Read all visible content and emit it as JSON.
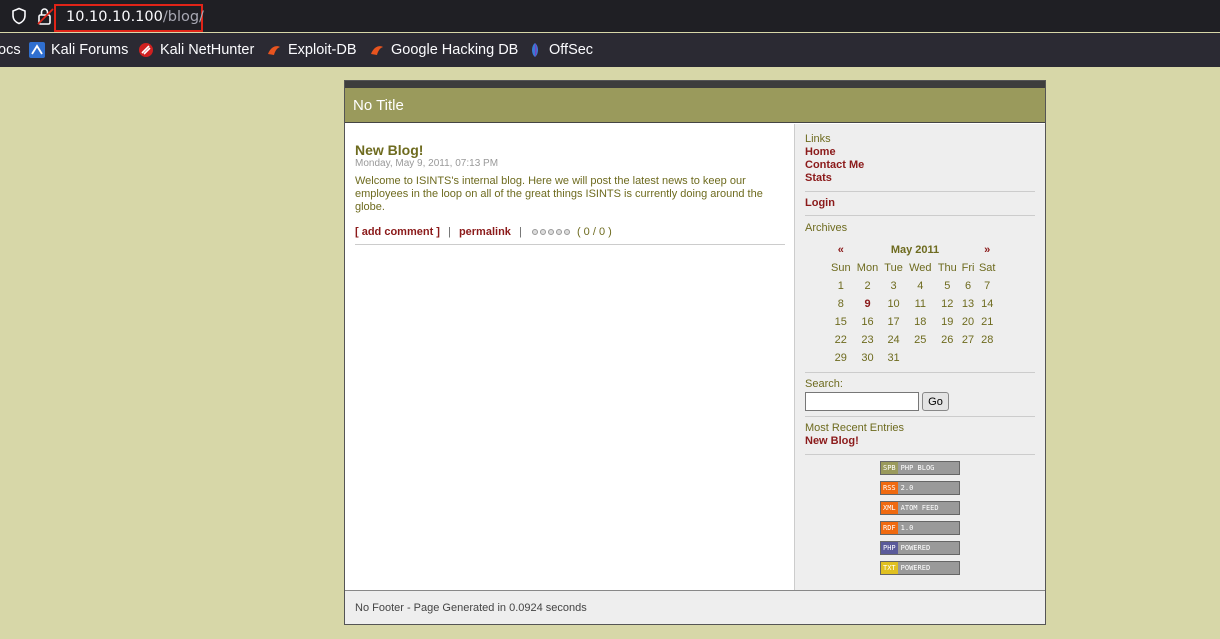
{
  "browser": {
    "url_host": "10.10.10.100",
    "url_path": "/blog/",
    "bookmarks": [
      {
        "label": "ocs",
        "icon": "truncated-bookmark"
      },
      {
        "label": "Kali Forums",
        "icon": "kali-forums-icon"
      },
      {
        "label": "Kali NetHunter",
        "icon": "kali-nethunter-icon"
      },
      {
        "label": "Exploit-DB",
        "icon": "exploit-db-icon"
      },
      {
        "label": "Google Hacking DB",
        "icon": "google-hacking-db-icon"
      },
      {
        "label": "OffSec",
        "icon": "offsec-icon"
      }
    ]
  },
  "blog": {
    "title": "No Title",
    "entry": {
      "title": "New Blog!",
      "date": "Monday, May 9, 2011, 07:13 PM",
      "body": "Welcome to ISINTS's internal blog. Here we will post the latest news to keep our employees in the loop on all of the great things ISINTS is currently doing around the globe.",
      "add_comment": "[ add comment ]",
      "separator": "|",
      "permalink": "permalink",
      "rating": "( 0 / 0 )"
    },
    "sidebar": {
      "links_label": "Links",
      "links": [
        "Home",
        "Contact Me",
        "Stats"
      ],
      "login": "Login",
      "archives_label": "Archives",
      "calendar": {
        "prev": "«",
        "month": "May 2011",
        "next": "»",
        "days_of_week": [
          "Sun",
          "Mon",
          "Tue",
          "Wed",
          "Thu",
          "Fri",
          "Sat"
        ],
        "weeks": [
          [
            "1",
            "2",
            "3",
            "4",
            "5",
            "6",
            "7"
          ],
          [
            "8",
            "9",
            "10",
            "11",
            "12",
            "13",
            "14"
          ],
          [
            "15",
            "16",
            "17",
            "18",
            "19",
            "20",
            "21"
          ],
          [
            "22",
            "23",
            "24",
            "25",
            "26",
            "27",
            "28"
          ],
          [
            "29",
            "30",
            "31",
            "",
            "",
            "",
            ""
          ]
        ],
        "highlighted_day": "9"
      },
      "search_label": "Search:",
      "search_value": "",
      "go_button": "Go",
      "recent_label": "Most Recent Entries",
      "recent_entries": [
        "New Blog!"
      ],
      "badges": [
        {
          "left": "SPB",
          "right": "PHP BLOG",
          "color": "#9a9a5c"
        },
        {
          "left": "RSS",
          "right": "2.0",
          "color": "#f06a10"
        },
        {
          "left": "XML",
          "right": "ATOM FEED",
          "color": "#f06a10"
        },
        {
          "left": "RDF",
          "right": "1.0",
          "color": "#f06a10"
        },
        {
          "left": "PHP",
          "right": "POWERED",
          "color": "#5a5a9a"
        },
        {
          "left": "TXT",
          "right": "POWERED",
          "color": "#e0c020"
        }
      ]
    },
    "footer": "No Footer - Page Generated in 0.0924 seconds"
  }
}
